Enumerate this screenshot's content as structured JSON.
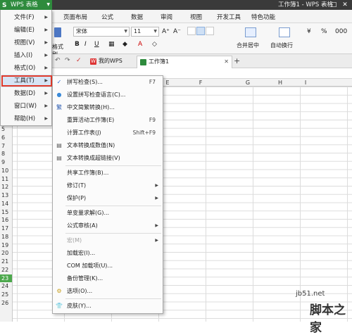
{
  "app": {
    "name": "WPS 表格",
    "doc_title": "工作簿1 - WPS 表格"
  },
  "ribbon_tabs": [
    "页面布局",
    "公式",
    "数据",
    "审阅",
    "视图",
    "开发工具",
    "特色功能"
  ],
  "ribbon": {
    "format_painter": "格式刷",
    "font_name": "宋体",
    "font_size": "11",
    "merge_label": "合并居中",
    "wrap_label": "自动换行",
    "bold": "B",
    "italic": "I",
    "underline": "U",
    "grow": "A⁺",
    "shrink": "A⁻"
  },
  "tabs": {
    "mywps": "我的WPS",
    "workbook": "工作簿1",
    "add": "+"
  },
  "columns": [
    "E",
    "F",
    "G",
    "H",
    "I"
  ],
  "rows": [
    "5",
    "6",
    "7",
    "8",
    "9",
    "10",
    "11",
    "12",
    "13",
    "14",
    "15",
    "16",
    "17",
    "18",
    "19",
    "20",
    "21",
    "22",
    "23",
    "24",
    "25",
    "26"
  ],
  "selected_row": "23",
  "main_menu": [
    {
      "label": "文件(F)"
    },
    {
      "label": "编辑(E)"
    },
    {
      "label": "视图(V)"
    },
    {
      "label": "插入(I)"
    },
    {
      "label": "格式(O)"
    },
    {
      "label": "工具(T)"
    },
    {
      "label": "数据(D)"
    },
    {
      "label": "窗口(W)"
    },
    {
      "label": "帮助(H)"
    }
  ],
  "tools_menu": [
    {
      "label": "拼写检查(S)...",
      "shortcut": "F7"
    },
    {
      "label": "设置拼写检查语言(C)..."
    },
    {
      "label": "中文简繁转换(H)..."
    },
    {
      "label": "重算活动工作簿(E)",
      "shortcut": "F9"
    },
    {
      "label": "计算工作表(J)",
      "shortcut": "Shift+F9"
    },
    {
      "label": "文本转换成数值(N)"
    },
    {
      "label": "文本转换成超链接(V)"
    },
    {
      "label": "共享工作簿(B)..."
    },
    {
      "label": "修订(T)"
    },
    {
      "label": "保护(P)"
    },
    {
      "label": "单变量求解(G)..."
    },
    {
      "label": "公式审核(A)"
    },
    {
      "label": "宏(M)"
    },
    {
      "label": "加载宏(I)..."
    },
    {
      "label": "COM 加载项(U)..."
    },
    {
      "label": "备份管理(K)..."
    },
    {
      "label": "选项(O)..."
    },
    {
      "label": "皮肤(Y)..."
    }
  ],
  "watermark": {
    "line1": "jb51.net",
    "line2": "脚本之家"
  },
  "colors": {
    "wps_green": "#2e8b3d",
    "highlight_box": "#e03a2a",
    "selected_row": "#4ca84c"
  }
}
